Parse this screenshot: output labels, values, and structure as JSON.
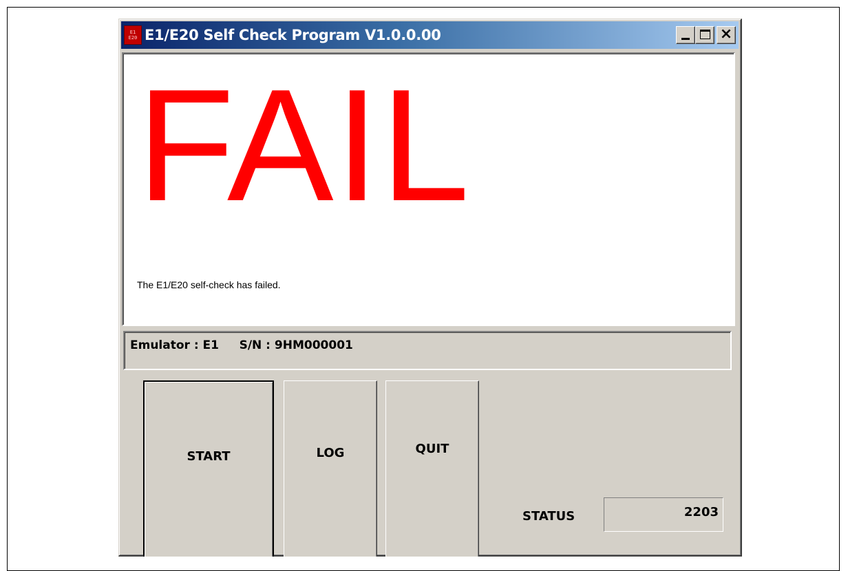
{
  "window": {
    "title": "E1/E20 Self Check Program V1.0.0.00",
    "icon": "app-icon",
    "controls": {
      "minimize_icon": "minimize-icon",
      "maximize_icon": "maximize-icon",
      "close_icon": "close-icon",
      "close_glyph": "×"
    }
  },
  "result": {
    "headline": "FAIL",
    "headline_color": "#ff0000",
    "message": "The E1/E20 self-check has failed."
  },
  "info": {
    "text": "Emulator : E1     S/N : 9HM000001"
  },
  "buttons": {
    "start": "START",
    "log": "LOG",
    "quit": "QUIT"
  },
  "status": {
    "label": "STATUS",
    "value": "2203"
  }
}
